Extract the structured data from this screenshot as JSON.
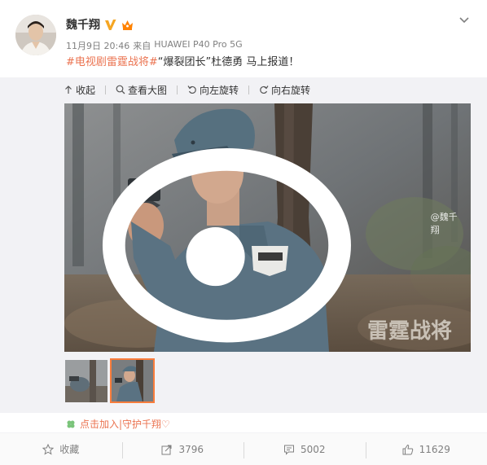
{
  "user": {
    "name": "魏千翔"
  },
  "meta": {
    "date": "11月9日 20:46",
    "source_prefix": "来自",
    "source_device": "HUAWEI P40 Pro 5G"
  },
  "post": {
    "hashtag": "#电视剧雷霆战将#",
    "text": "“爆裂团长”杜德勇 马上报道！"
  },
  "media_toolbar": {
    "collapse_label": "收起",
    "view_large_label": "查看大图",
    "rotate_left_label": "向左旋转",
    "rotate_right_label": "向右旋转"
  },
  "photo": {
    "watermark_title": "雷霆战将",
    "watermark_user": "@魏千翔"
  },
  "support_link": {
    "label": "点击加入|守护千翔♡"
  },
  "actions": {
    "favorite_label": "收藏",
    "repost_count": "3796",
    "comment_count": "5002",
    "like_count": "11629"
  },
  "colors": {
    "hashtag": "#eb7350",
    "selected_thumb_border": "#fa7d3c",
    "verified_badge": "#f5a623"
  }
}
